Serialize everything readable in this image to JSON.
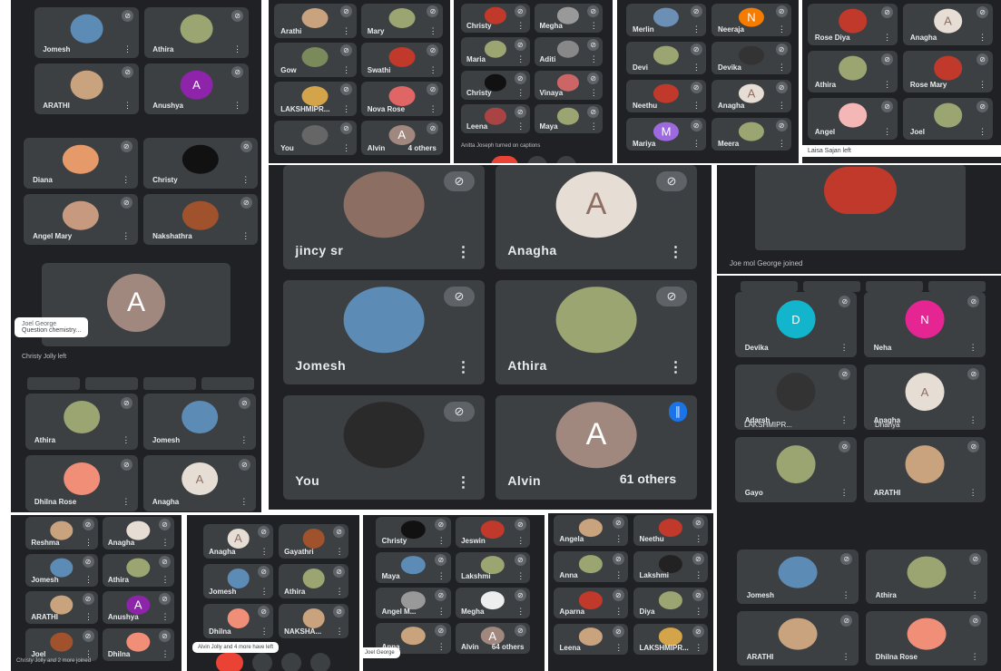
{
  "colors": {
    "panel": "#202124",
    "tile": "#3c4043",
    "mic": "#5f6368",
    "end_call": "#ea4335",
    "speaking": "#1a73e8"
  },
  "main": {
    "tiles": [
      {
        "name": "jincy sr",
        "avatar": "",
        "avatar_color": "#8d6e63"
      },
      {
        "name": "Anagha",
        "avatar": "A",
        "avatar_color": "#e6ddd4"
      },
      {
        "name": "Jomesh",
        "avatar": "",
        "avatar_color": "#5c8bb5"
      },
      {
        "name": "Athira",
        "avatar": "",
        "avatar_color": "#9aa571"
      },
      {
        "name": "You",
        "avatar": "",
        "avatar_color": "#2a2a2a"
      },
      {
        "name": "Alvin",
        "avatar": "A",
        "avatar_color": "#a1887f",
        "others": "61 others",
        "speaking": true
      }
    ]
  },
  "left_top": {
    "tiles": [
      {
        "name": "Jomesh",
        "avatar_color": "#5c8bb5"
      },
      {
        "name": "Athira",
        "avatar_color": "#9aa571"
      },
      {
        "name": "ARATHI",
        "avatar_color": "#c9a27e"
      },
      {
        "name": "Anushya",
        "avatar": "A",
        "avatar_color": "#8e24aa"
      }
    ]
  },
  "left_mid": {
    "tiles": [
      {
        "name": "Diana",
        "avatar_color": "#e69a6a"
      },
      {
        "name": "Christy",
        "avatar_color": "#111111"
      },
      {
        "name": "Angel Mary",
        "avatar_color": "#c79a80"
      },
      {
        "name": "Nakshathra",
        "avatar_color": "#a0522d"
      }
    ],
    "big_avatar": "A",
    "toast_name": "Joel George",
    "toast_text": "Question chemistry...",
    "left_note": "Christy Jolly left"
  },
  "left_bottom": {
    "tiles": [
      {
        "name": "Athira",
        "avatar_color": "#9aa571"
      },
      {
        "name": "Jomesh",
        "avatar_color": "#5c8bb5"
      },
      {
        "name": "Dhilna Rose",
        "avatar_color": "#f08e78"
      },
      {
        "name": "Anagha",
        "avatar": "A",
        "avatar_color": "#e6ddd4"
      }
    ]
  },
  "top_center": {
    "tiles": [
      {
        "name": "Arathi",
        "avatar_color": "#c9a27e"
      },
      {
        "name": "Mary",
        "avatar_color": "#9aa571"
      },
      {
        "name": "Gow",
        "avatar_color": "#7a8a5a"
      },
      {
        "name": "Swathi",
        "avatar_color": "#c0392b"
      },
      {
        "name": "LAKSHMIPR...",
        "avatar_color": "#d4a44a"
      },
      {
        "name": "Nova Rose",
        "avatar_color": "#e06666"
      },
      {
        "name": "You",
        "avatar_color": "#666"
      },
      {
        "name": "Alvin",
        "avatar": "A",
        "avatar_color": "#a1887f",
        "others": "4 others"
      }
    ]
  },
  "top_mid2": {
    "tiles": [
      {
        "name": "Christy",
        "avatar_color": "#c0392b"
      },
      {
        "name": "Megha",
        "avatar_color": "#999"
      },
      {
        "name": "Maria",
        "avatar_color": "#9aa571"
      },
      {
        "name": "Aditi",
        "avatar_color": "#888"
      },
      {
        "name": "Christy",
        "avatar_color": "#111"
      },
      {
        "name": "Vinaya",
        "avatar_color": "#cc6666"
      },
      {
        "name": "Leena",
        "avatar_color": "#aa4444"
      },
      {
        "name": "Maya",
        "avatar_color": "#9aa571"
      }
    ],
    "note": "Anitta Joseph turned on captions"
  },
  "top_mid3": {
    "tiles": [
      {
        "name": "Merlin",
        "avatar_color": "#6b8fb5"
      },
      {
        "name": "Neeraja",
        "avatar": "N",
        "avatar_color": "#f57c00"
      },
      {
        "name": "Devi",
        "avatar_color": "#9aa571"
      },
      {
        "name": "Devika",
        "avatar_color": "#333"
      },
      {
        "name": "Neethu",
        "avatar_color": "#c0392b"
      },
      {
        "name": "Anagha",
        "avatar": "A",
        "avatar_color": "#e6ddd4"
      },
      {
        "name": "Mariya",
        "avatar": "M",
        "avatar_color": "#9c6ade"
      },
      {
        "name": "Meera",
        "avatar_color": "#9aa571"
      }
    ]
  },
  "top_right": {
    "tiles": [
      {
        "name": "Rose Diya",
        "avatar_color": "#c0392b"
      },
      {
        "name": "Anagha",
        "avatar": "A",
        "avatar_color": "#e6ddd4"
      },
      {
        "name": "Athira",
        "avatar_color": "#9aa571"
      },
      {
        "name": "Rose Mary",
        "avatar_color": "#c0392b"
      },
      {
        "name": "Angel",
        "avatar_color": "#f5b6b6"
      },
      {
        "name": "Joel",
        "avatar_color": "#9aa571"
      }
    ],
    "toast": "Laisa Sajan left"
  },
  "right_mid": {
    "note": "Joe mol George joined",
    "avatar_color": "#c0392b"
  },
  "right_grid": {
    "tiles": [
      {
        "name": "Devika",
        "avatar": "D",
        "avatar_color": "#12b5cb"
      },
      {
        "name": "Neha",
        "avatar": "N",
        "avatar_color": "#e52592"
      },
      {
        "name": "Adarsh",
        "avatar_color": "#333"
      },
      {
        "name": "Anagha",
        "avatar": "A",
        "avatar_color": "#e6ddd4"
      },
      {
        "name": "Gayo",
        "avatar_color": "#9aa571"
      },
      {
        "name": "ARATHI",
        "avatar_color": "#c9a27e"
      }
    ],
    "row_labels": [
      "LAKSHMIPR...",
      "Dhanya"
    ]
  },
  "right_bottom": {
    "tiles": [
      {
        "name": "Jomesh",
        "avatar_color": "#5c8bb5"
      },
      {
        "name": "Athira",
        "avatar_color": "#9aa571"
      },
      {
        "name": "ARATHI",
        "avatar_color": "#c9a27e"
      },
      {
        "name": "Dhilna Rose",
        "avatar_color": "#f08e78"
      }
    ]
  },
  "bottom1": {
    "tiles": [
      {
        "name": "Reshma",
        "avatar_color": "#c9a27e"
      },
      {
        "name": "Anagha",
        "avatar_color": "#e6ddd4"
      },
      {
        "name": "Jomesh",
        "avatar_color": "#5c8bb5"
      },
      {
        "name": "Athira",
        "avatar_color": "#9aa571"
      },
      {
        "name": "ARATHI",
        "avatar_color": "#c9a27e"
      },
      {
        "name": "Anushya",
        "avatar": "A",
        "avatar_color": "#8e24aa"
      },
      {
        "name": "Joel",
        "avatar_color": "#a0522d"
      },
      {
        "name": "Dhilna",
        "avatar_color": "#f08e78"
      }
    ],
    "note": "Christy Jolly and 2 more joined"
  },
  "bottom2": {
    "tiles": [
      {
        "name": "Anagha",
        "avatar": "A",
        "avatar_color": "#e6ddd4"
      },
      {
        "name": "Gayathri",
        "avatar_color": "#a0522d"
      },
      {
        "name": "Jomesh",
        "avatar_color": "#5c8bb5"
      },
      {
        "name": "Athira",
        "avatar_color": "#9aa571"
      },
      {
        "name": "Dhilna",
        "avatar_color": "#f08e78"
      },
      {
        "name": "NAKSHA...",
        "avatar_color": "#c9a27e"
      }
    ],
    "toast": "Alvin Jolly and 4 more have left"
  },
  "bottom3": {
    "tiles": [
      {
        "name": "Christy",
        "avatar_color": "#111"
      },
      {
        "name": "Jeswin",
        "avatar_color": "#c0392b"
      },
      {
        "name": "Maya",
        "avatar_color": "#5c8bb5"
      },
      {
        "name": "Lakshmi",
        "avatar_color": "#9aa571"
      },
      {
        "name": "Angel M...",
        "avatar_color": "#999"
      },
      {
        "name": "Megha",
        "avatar_color": "#eee"
      },
      {
        "name": "Anna",
        "avatar_color": "#c9a27e"
      },
      {
        "name": "Alvin",
        "avatar": "A",
        "avatar_color": "#a1887f",
        "others": "64 others"
      }
    ],
    "toast": "Joel George"
  },
  "bottom4": {
    "tiles": [
      {
        "name": "Angela",
        "avatar_color": "#c9a27e"
      },
      {
        "name": "Neethu",
        "avatar_color": "#c0392b"
      },
      {
        "name": "Anna",
        "avatar_color": "#9aa571"
      },
      {
        "name": "Lakshmi",
        "avatar_color": "#222"
      },
      {
        "name": "Aparna",
        "avatar_color": "#c0392b"
      },
      {
        "name": "Diya",
        "avatar_color": "#9aa571"
      },
      {
        "name": "Leena",
        "avatar_color": "#c9a27e"
      },
      {
        "name": "LAKSHMIPR...",
        "avatar_color": "#d4a44a"
      }
    ]
  }
}
